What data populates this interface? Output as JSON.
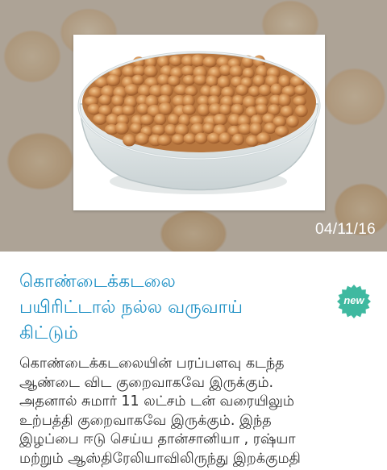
{
  "article": {
    "date": "04/11/16",
    "badge": "new",
    "headline_lines": [
      "கொண்டைக்கடலை",
      "பயிரிட்டால் நல்ல வருவாய்",
      "கிட்டும்"
    ],
    "body_lines": [
      "கொண்டைக்கடலையின் பரப்பளவு கடந்த",
      "ஆண்டை விட குறைவாகவே இருக்கும்.",
      "அதனால் சுமார் 11 லட்சம் டன் வரையிலும்",
      "உற்பத்தி குறைவாகவே இருக்கும். இந்த",
      "இழப்பை ஈடு செய்ய தான்சானியா , ரஷ்யா",
      "மற்றும் ஆஸ்திரேலியாவிலிருந்து இறக்குமதி"
    ]
  },
  "colors": {
    "headline": "#1c8fc4",
    "badge": "#3fb9a0",
    "body_text": "#2b2b2b"
  },
  "icons": {
    "badge": "new-badge-icon"
  }
}
